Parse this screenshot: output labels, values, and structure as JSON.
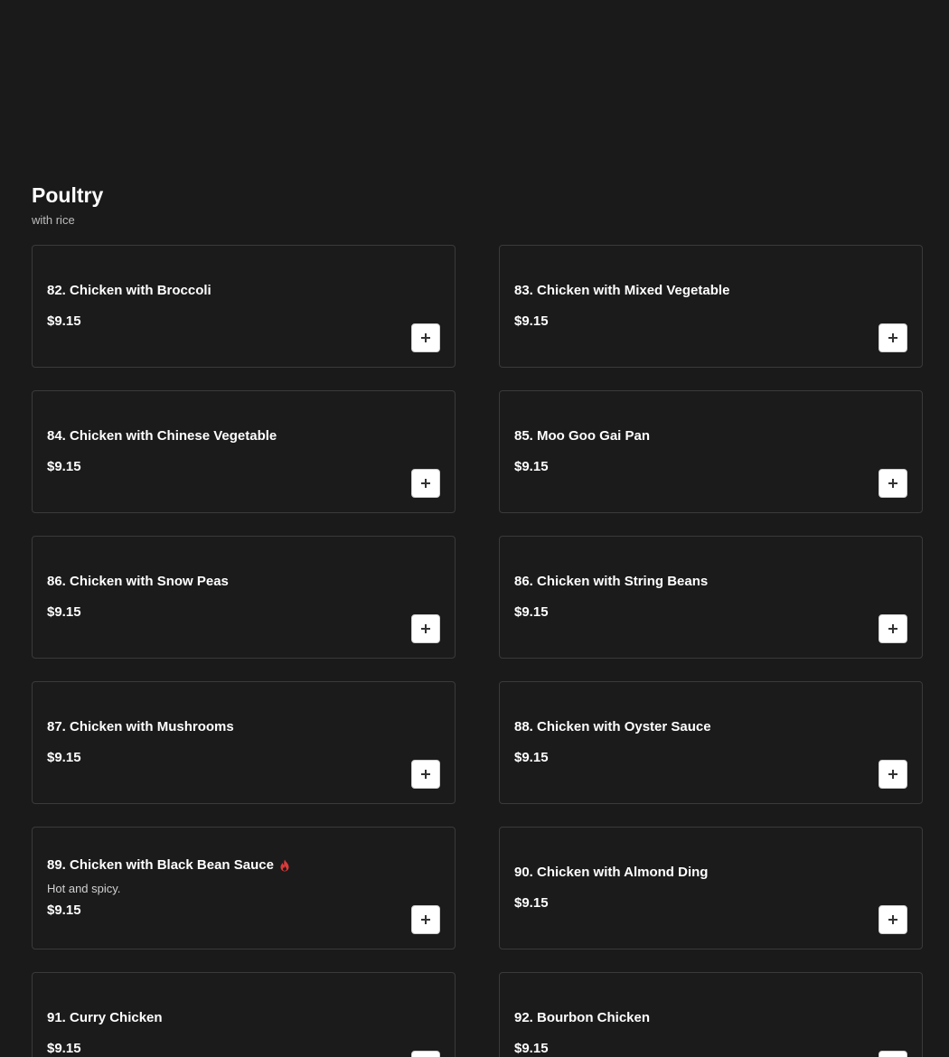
{
  "section": {
    "title": "Poultry",
    "subtitle": "with rice"
  },
  "colors": {
    "background": "#1a1a1a",
    "card_border": "#3a3a3a",
    "spicy": "#d93a3a"
  },
  "items": [
    {
      "name": "82. Chicken with Broccoli",
      "price": "$9.15",
      "description": "",
      "spicy": false
    },
    {
      "name": "83. Chicken with Mixed Vegetable",
      "price": "$9.15",
      "description": "",
      "spicy": false
    },
    {
      "name": "84. Chicken with Chinese Vegetable",
      "price": "$9.15",
      "description": "",
      "spicy": false
    },
    {
      "name": "85. Moo Goo Gai Pan",
      "price": "$9.15",
      "description": "",
      "spicy": false
    },
    {
      "name": "86. Chicken with Snow Peas",
      "price": "$9.15",
      "description": "",
      "spicy": false
    },
    {
      "name": "86. Chicken with String Beans",
      "price": "$9.15",
      "description": "",
      "spicy": false
    },
    {
      "name": "87. Chicken with Mushrooms",
      "price": "$9.15",
      "description": "",
      "spicy": false
    },
    {
      "name": "88. Chicken with Oyster Sauce",
      "price": "$9.15",
      "description": "",
      "spicy": false
    },
    {
      "name": "89. Chicken with Black Bean Sauce",
      "price": "$9.15",
      "description": "Hot and spicy.",
      "spicy": true
    },
    {
      "name": "90. Chicken with Almond Ding",
      "price": "$9.15",
      "description": "",
      "spicy": false
    },
    {
      "name": "91. Curry Chicken",
      "price": "$9.15",
      "description": "",
      "spicy": false
    },
    {
      "name": "92. Bourbon Chicken",
      "price": "$9.15",
      "description": "",
      "spicy": false
    }
  ],
  "icons": {
    "add": "plus-icon",
    "spicy": "flame-icon"
  }
}
